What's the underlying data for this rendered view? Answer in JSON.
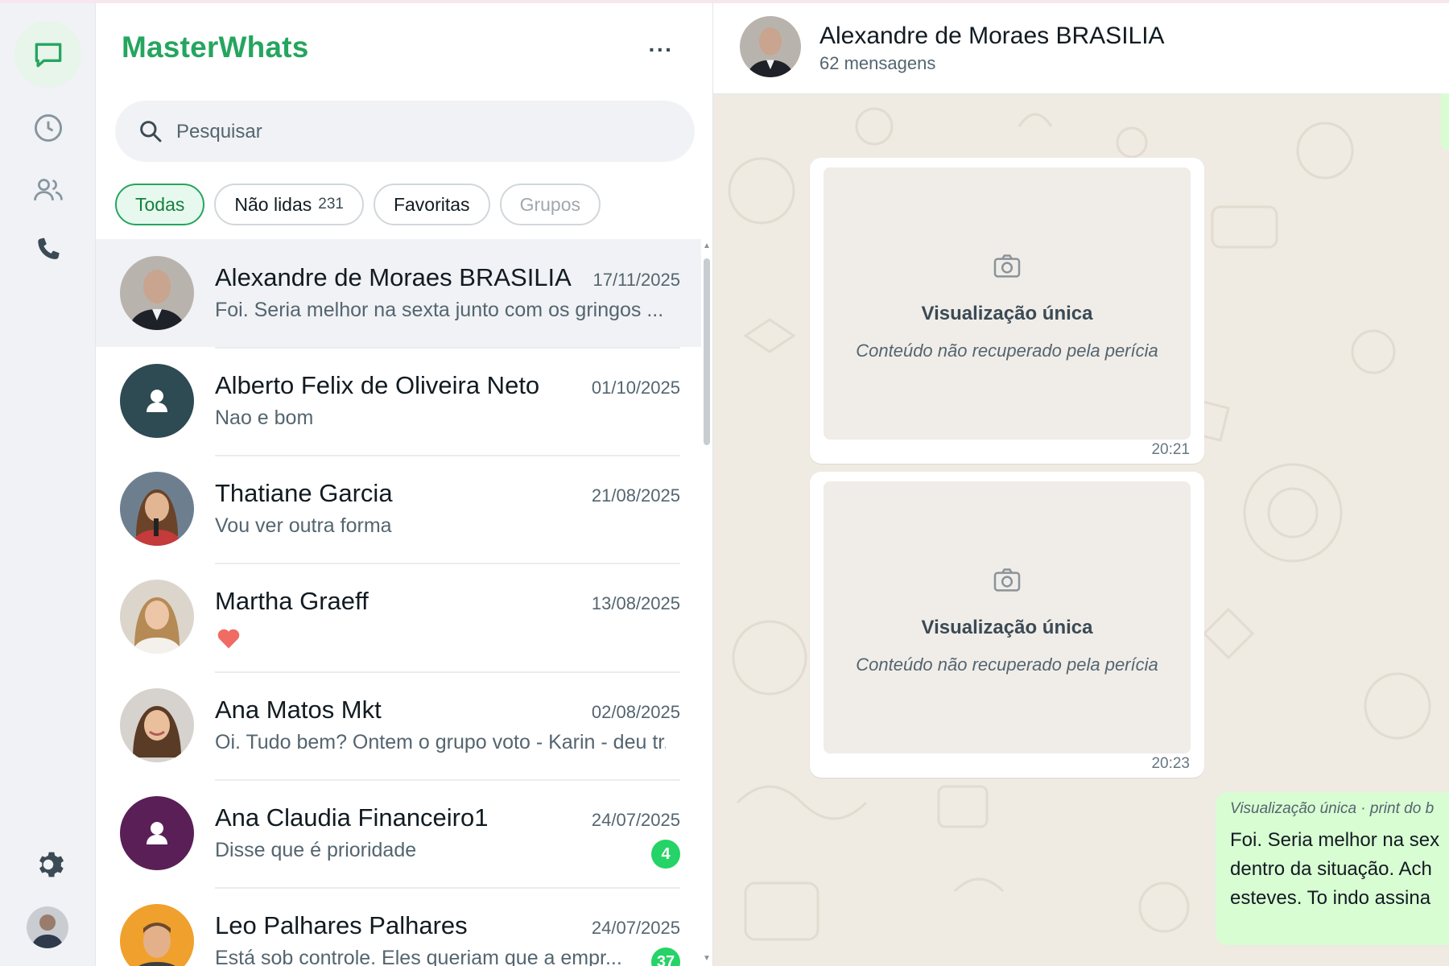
{
  "app": {
    "brand": "MasterWhats",
    "more_label": "···"
  },
  "rail": {
    "items": [
      {
        "name": "chats",
        "icon": "chat-bubble-icon",
        "active": true
      },
      {
        "name": "status",
        "icon": "status-clock-icon"
      },
      {
        "name": "contacts",
        "icon": "contacts-icon"
      },
      {
        "name": "calls",
        "icon": "phone-icon"
      }
    ],
    "settings_icon": "gear-icon",
    "profile_icon": "profile-avatar"
  },
  "search": {
    "placeholder": "Pesquisar",
    "value": ""
  },
  "filters": [
    {
      "label": "Todas",
      "active": true
    },
    {
      "label": "Não lidas",
      "count": "231"
    },
    {
      "label": "Favoritas"
    },
    {
      "label": "Grupos",
      "dimmed": true
    }
  ],
  "chats": [
    {
      "name": "Alexandre de Moraes BRASILIA",
      "date": "17/11/2025",
      "preview": "Foi. Seria melhor na sexta junto com os gringos ...",
      "selected": true
    },
    {
      "name": "Alberto Felix de Oliveira Neto",
      "date": "01/10/2025",
      "preview": "Nao e bom"
    },
    {
      "name": "Thatiane Garcia",
      "date": "21/08/2025",
      "preview": "Vou ver outra forma"
    },
    {
      "name": "Martha Graeff",
      "date": "13/08/2025",
      "preview": ""
    },
    {
      "name": "Ana Matos Mkt",
      "date": "02/08/2025",
      "preview": "Oi. Tudo bem? Ontem o grupo voto - Karin - deu tr..."
    },
    {
      "name": "Ana Claudia Financeiro1",
      "date": "24/07/2025",
      "preview": "Disse que é prioridade",
      "unread": "4"
    },
    {
      "name": "Leo Palhares Palhares",
      "date": "24/07/2025",
      "preview": "Está sob controle. Eles queriam que a empr...",
      "unread": "37"
    }
  ],
  "conversation": {
    "title": "Alexandre de Moraes BRASILIA",
    "subtitle": "62 mensagens",
    "messages": [
      {
        "type": "view-once",
        "title": "Visualização única",
        "note": "Conteúdo não recuperado pela perícia",
        "time": "20:21"
      },
      {
        "type": "view-once",
        "title": "Visualização única",
        "note": "Conteúdo não recuperado pela perícia",
        "time": "20:23"
      },
      {
        "type": "outgoing",
        "meta": "Visualização única · print do b",
        "lines": [
          "Foi. Seria melhor na sex",
          "dentro da situação. Ach",
          "esteves. To indo assina"
        ]
      }
    ]
  },
  "colors": {
    "brand": "#25a55f",
    "unread_badge": "#25d366",
    "outgoing_bubble": "#d9fdd3",
    "wallpaper": "#efeae2",
    "avatar_alberto": "#2e4a52",
    "avatar_ana_claudia": "#5a1f57"
  }
}
